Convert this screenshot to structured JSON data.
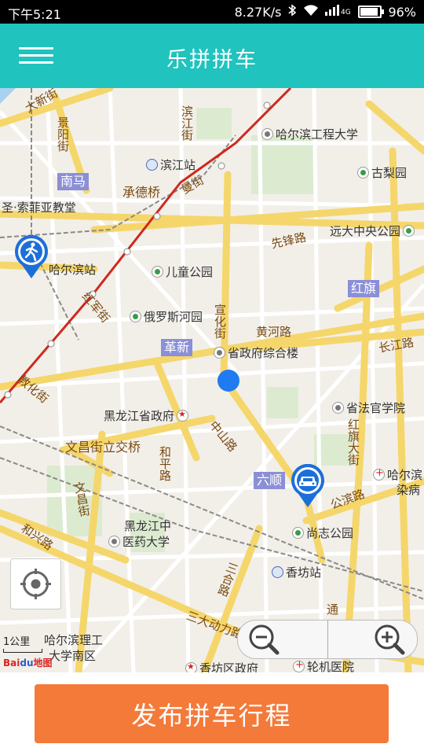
{
  "status_bar": {
    "time": "下午5:21",
    "net_speed": "8.27K/s",
    "battery": "96%",
    "battery_level": 0.96,
    "icons": [
      "bluetooth-icon",
      "wifi-icon",
      "signal-icon",
      "battery-icon"
    ]
  },
  "app_bar": {
    "title": "乐拼拼车",
    "menu_icon": "hamburger-menu-icon"
  },
  "map": {
    "labels": {
      "daxin_st": "大新街",
      "jingyang_st": "景阳街",
      "binjiang_st": "滨江街",
      "hit": "哈尔滨工程大学",
      "binjiang_station": "滨江站",
      "gulin_park": "古梨园",
      "nanma": "南马",
      "chengde_bridge": "承德桥",
      "man_st": "曼街",
      "sophia": "圣·索菲亚教堂",
      "xianfeng_rd": "先锋路",
      "yuanda": "远大中央公园",
      "harbin_station": "哈尔滨站",
      "children_park": "儿童公园",
      "hongqi": "红旗",
      "hongjun_st": "红军街",
      "russia_park": "俄罗斯河园",
      "xuanhua_st": "宣化街",
      "huanghe_rd": "黄河路",
      "gexin": "革新",
      "gov_building": "省政府综合楼",
      "changjiang_rd": "长江路",
      "jiaohua_st": "教化街",
      "hlj_gov": "黑龙江省政府",
      "law_college": "省法官学院",
      "zhongshan_rd": "中山路",
      "wenchang_bridge": "文昌街立交桥",
      "hongqi_ave": "红旗大街",
      "heping_rd": "和平路",
      "liushun": "六顺",
      "hospital": "哈尔滨",
      "hospital_2": "染病",
      "wenchang_st": "文昌街",
      "gongbin_rd": "公滨路",
      "tcm_univ_1": "黑龙江中",
      "tcm_univ_2": "医药大学",
      "shangzhi_park": "尚志公园",
      "hexing_rd": "和兴路",
      "xiangfang_station": "香坊站",
      "sanhe_rd": "三合路",
      "tong_st": "通",
      "sandadongli_rd": "三大动力路",
      "hust_1": "哈尔滨理工",
      "hust_2": "大学南区",
      "xiangfang_gov": "香坊区政府",
      "engine_hospital": "轮机医院"
    },
    "user_location_icon": "current-location-dot-icon",
    "walk_pin_icon": "pedestrian-pin-icon",
    "car_pin_icon": "car-pin-icon",
    "locate_icon": "locate-crosshair-icon",
    "zoom_out_icon": "zoom-out-icon",
    "zoom_in_icon": "zoom-in-icon",
    "scale_label": "1公里",
    "logo": {
      "part1": "Bai",
      "part2": "du",
      "part3": "地图"
    }
  },
  "footer": {
    "publish_button": "发布拼车行程"
  },
  "colors": {
    "accent": "#20c3bd",
    "button": "#f47a3a",
    "location_dot": "#1e7bf0",
    "railway": "#d0281e",
    "district_label_bg": "#8b8fd6",
    "map_bg": "#f2efe9"
  }
}
